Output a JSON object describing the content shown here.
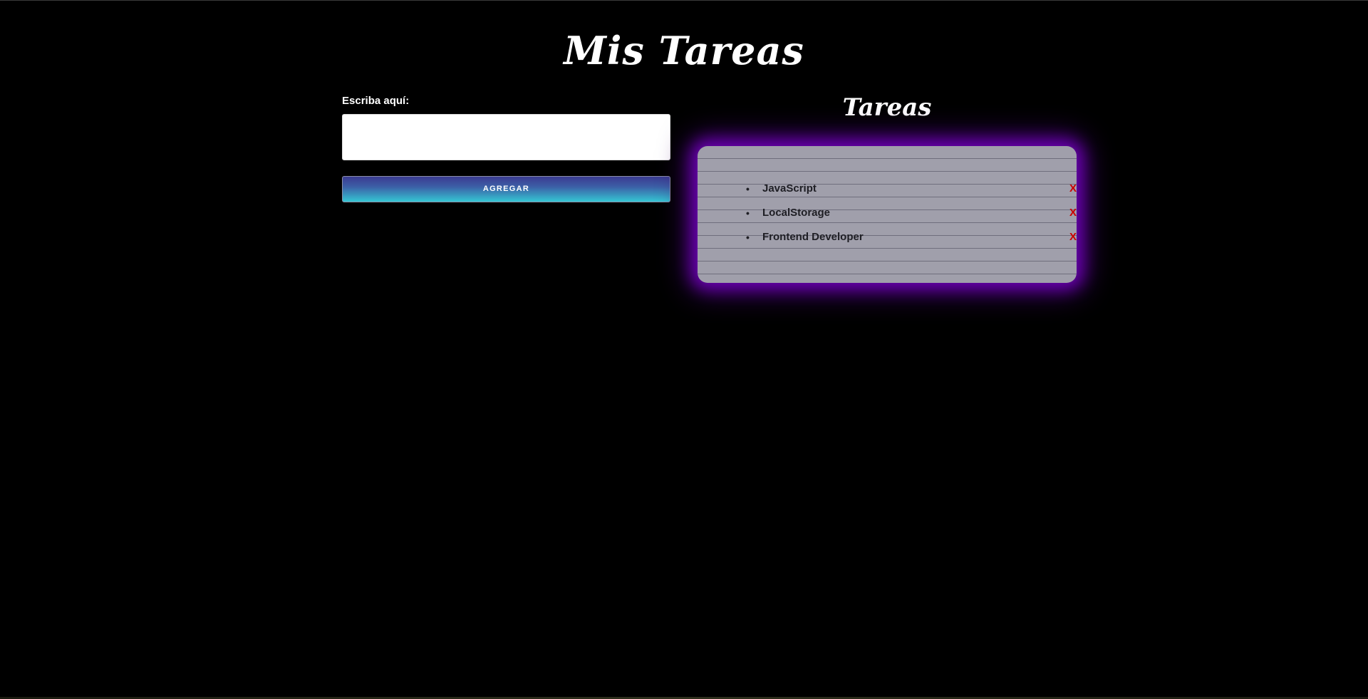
{
  "header": {
    "title": "Mis Tareas"
  },
  "form": {
    "label": "Escriba aquí:",
    "input_value": "",
    "input_placeholder": "",
    "add_button_label": "AGREGAR"
  },
  "tasks": {
    "heading": "Tareas",
    "items": [
      {
        "label": "JavaScript",
        "delete_label": "X"
      },
      {
        "label": "LocalStorage",
        "delete_label": "X"
      },
      {
        "label": "Frontend Developer",
        "delete_label": "X"
      }
    ],
    "bullet": "•"
  },
  "colors": {
    "background": "#000000",
    "card": "#a09fab",
    "card_glow": "#6a00b0",
    "delete": "#cc0000",
    "button_gradient_top": "#3b3b91",
    "button_gradient_bottom": "#36c6d4"
  }
}
